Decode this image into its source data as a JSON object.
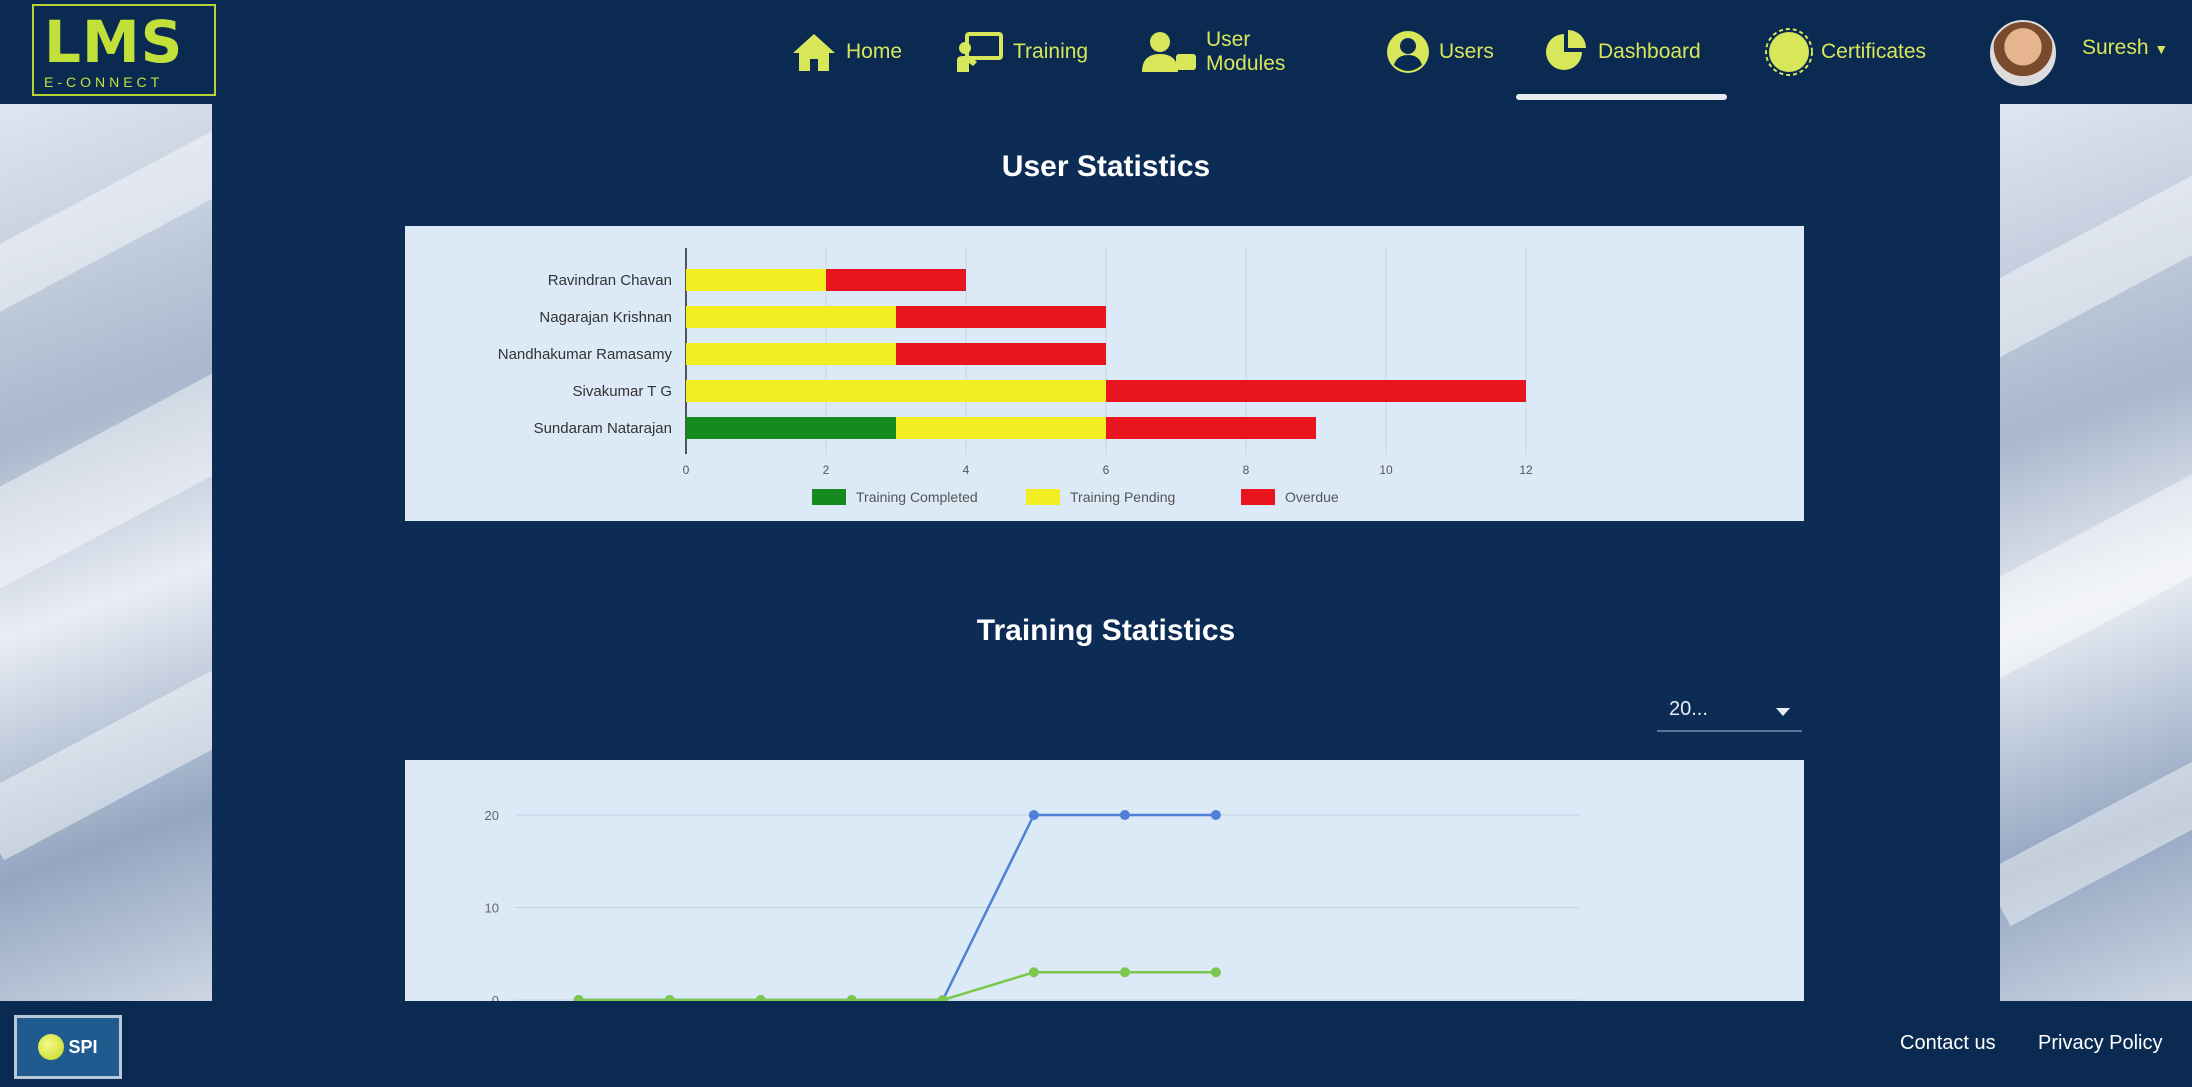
{
  "brand": {
    "logo_text": "LMS",
    "logo_sub": "E-CONNECT"
  },
  "nav": {
    "items": [
      {
        "label": "Home",
        "icon": "home-icon"
      },
      {
        "label": "Training",
        "icon": "training-icon"
      },
      {
        "label": "User Modules",
        "icon": "user-modules-icon"
      },
      {
        "label": "Users",
        "icon": "user-icon"
      },
      {
        "label": "Dashboard",
        "icon": "dashboard-icon",
        "active": true
      },
      {
        "label": "Certificates",
        "icon": "certificate-icon"
      }
    ],
    "user": {
      "name": "Suresh",
      "icon": "chevron-down-icon"
    }
  },
  "colors": {
    "accent": "#d8e65a",
    "header_bg": "#0b2a52",
    "panel_bg": "#dce9f7",
    "completed": "#178a1e",
    "pending": "#f2ee22",
    "overdue": "#e8141e",
    "line_blue": "#4f7fd6",
    "line_green": "#7cc84f"
  },
  "user_statistics": {
    "title": "User Statistics",
    "chart_data": {
      "type": "bar",
      "orientation": "horizontal",
      "stacked": true,
      "categories": [
        "Ravindran Chavan",
        "Nagarajan Krishnan",
        "Nandhakumar Ramasamy",
        "Sivakumar T G",
        "Sundaram Natarajan"
      ],
      "series": [
        {
          "name": "Training Completed",
          "color": "#178a1e",
          "values": [
            0,
            0,
            0,
            0,
            3
          ]
        },
        {
          "name": "Training Pending",
          "color": "#f2ee22",
          "values": [
            2,
            3,
            3,
            6,
            3
          ]
        },
        {
          "name": "Overdue",
          "color": "#e8141e",
          "values": [
            2,
            3,
            3,
            6,
            3
          ]
        }
      ],
      "x_ticks": [
        "0",
        "2",
        "4",
        "6",
        "8",
        "10",
        "12"
      ],
      "xlim": [
        0,
        12
      ],
      "legend_position": "bottom",
      "grid": true
    }
  },
  "training_statistics": {
    "title": "Training Statistics",
    "select": {
      "value": "20..."
    },
    "chart_data": {
      "type": "line",
      "y_ticks": [
        "0",
        "10",
        "20"
      ],
      "ylim": [
        0,
        20
      ],
      "grid": true,
      "series": [
        {
          "color": "#4f7fd6",
          "x": [
            1,
            2,
            3,
            4,
            5,
            6,
            7,
            8
          ],
          "y": [
            0,
            0,
            0,
            0,
            0,
            20,
            20,
            20
          ]
        },
        {
          "color": "#7cc84f",
          "x": [
            1,
            2,
            3,
            4,
            5,
            6,
            7,
            8
          ],
          "y": [
            0,
            0,
            0,
            0,
            0,
            3,
            3,
            3
          ]
        }
      ],
      "x_range": [
        0.3,
        12
      ]
    }
  },
  "footer": {
    "logo_text": "SPI",
    "links": [
      "Contact us",
      "Privacy Policy"
    ]
  }
}
